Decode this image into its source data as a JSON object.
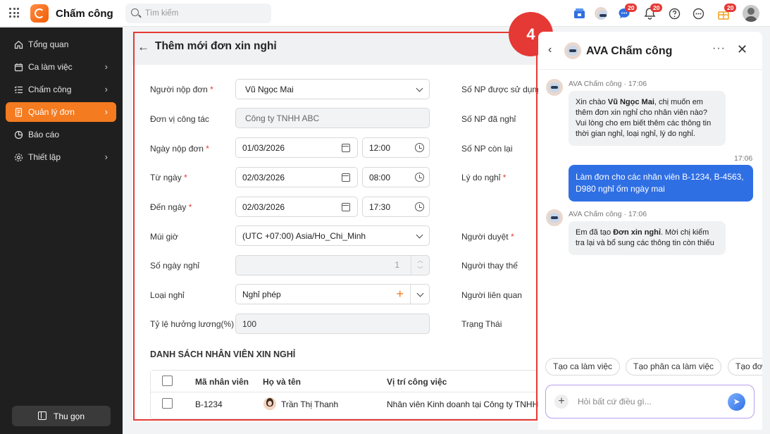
{
  "app": {
    "name": "Chấm công",
    "search_placeholder": "Tìm kiếm",
    "badges": {
      "chat": "20",
      "bell": "20",
      "gift": "20"
    }
  },
  "sidebar": {
    "items": [
      {
        "label": "Tổng quan",
        "icon": "home-icon",
        "chevron": false
      },
      {
        "label": "Ca làm việc",
        "icon": "calendar-icon",
        "chevron": true
      },
      {
        "label": "Chấm công",
        "icon": "list-check-icon",
        "chevron": true
      },
      {
        "label": "Quản lý đơn",
        "icon": "document-icon",
        "chevron": true,
        "active": true
      },
      {
        "label": "Báo cáo",
        "icon": "pie-chart-icon",
        "chevron": false
      },
      {
        "label": "Thiết lập",
        "icon": "gear-icon",
        "chevron": true
      }
    ],
    "collapse_label": "Thu gọn"
  },
  "page": {
    "title": "Thêm mới đơn xin nghỉ",
    "form": {
      "applicant": {
        "label": "Người nộp đơn",
        "value": "Vũ Ngọc Mai"
      },
      "unit": {
        "label": "Đơn vị công tác",
        "value": "Công ty TNHH ABC"
      },
      "submit_date": {
        "label": "Ngày nộp đơn",
        "date": "01/03/2026",
        "time": "12:00"
      },
      "from_date": {
        "label": "Từ ngày",
        "date": "02/03/2026",
        "time": "08:00"
      },
      "to_date": {
        "label": "Đến ngày",
        "date": "02/03/2026",
        "time": "17:30"
      },
      "timezone": {
        "label": "Múi giờ",
        "value": "(UTC +07:00) Asia/Ho_Chi_Minh"
      },
      "days_off": {
        "label": "Số ngày nghỉ",
        "value": "1"
      },
      "leave_type": {
        "label": "Loại nghỉ",
        "value": "Nghỉ phép"
      },
      "salary_rate": {
        "label": "Tỷ lệ hưởng lương(%)",
        "value": "100"
      }
    },
    "right_labels": {
      "np_allowed": "Số NP được sử dụng",
      "np_taken": "Số NP đã nghỉ",
      "np_remaining": "Số NP còn lại",
      "reason": "Lý do nghỉ",
      "approver": "Người duyệt",
      "substitute": "Người thay thế",
      "related": "Người liên quan",
      "status": "Trạng Thái"
    },
    "section_title": "DANH SÁCH NHÂN VIÊN XIN NGHỈ",
    "table": {
      "headers": [
        "Mã nhân viên",
        "Họ và tên",
        "Vị trí công việc"
      ],
      "rows": [
        {
          "code": "B-1234",
          "name": "Trần Thị Thanh",
          "position": "Nhân viên Kinh doanh tại Công ty TNHH"
        }
      ]
    }
  },
  "step_number": "4",
  "chat": {
    "title": "AVA Chấm công",
    "messages": [
      {
        "sender": "AVA Chấm công",
        "time": "17:06",
        "pre": "Xin chào ",
        "bold": "Vũ Ngọc Mai",
        "post": ", chị muốn em thêm đơn xin nghỉ cho nhân viên nào? Vui lòng cho em biết thêm các thông tin thời gian nghỉ, loại nghỉ, lý do nghỉ."
      },
      {
        "time": "17:06",
        "text": "Làm đơn cho các nhân viên B-1234, B-4563, D980 nghỉ ốm ngày mai"
      },
      {
        "sender": "AVA Chấm công",
        "time": "17:06",
        "pre": "Em đã tạo ",
        "bold": "Đơn xin nghỉ",
        "post": ". Mời chị kiểm tra lại và bổ sung các thông tin còn thiếu"
      }
    ],
    "chips": [
      "Tạo ca làm việc",
      "Tạo phân ca làm việc",
      "Tạo đơn"
    ],
    "input_placeholder": "Hỏi bất cứ điều gì..."
  }
}
